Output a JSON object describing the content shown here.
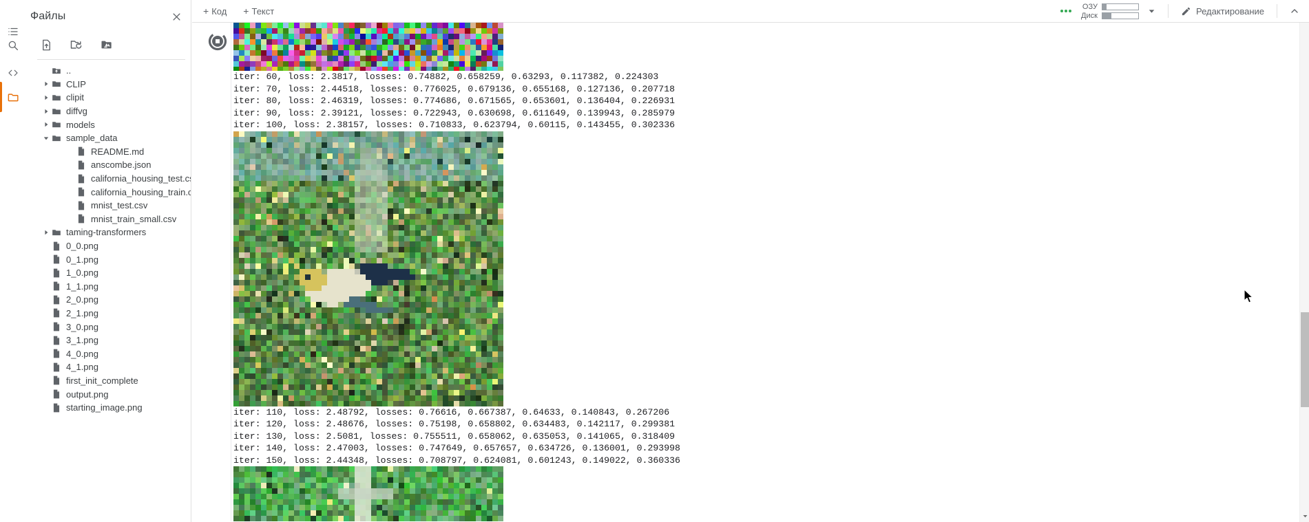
{
  "window": {
    "app": "Google Colab Notebook",
    "accent_color": "#e8710a",
    "text_color": "#3c4043",
    "background": "#ffffff"
  },
  "rail": {
    "items": [
      {
        "name": "table-of-contents-icon",
        "icon": "list-icon",
        "active": false
      },
      {
        "name": "search-icon",
        "icon": "search-icon",
        "active": false
      },
      {
        "name": "code-snippets-icon",
        "icon": "code-brackets-icon",
        "active": false
      },
      {
        "name": "files-icon",
        "icon": "folder-icon",
        "active": true
      }
    ]
  },
  "files_panel": {
    "title": "Файлы",
    "close_label": "×",
    "toolbar": [
      {
        "name": "upload-file-button",
        "icon": "upload-file-icon"
      },
      {
        "name": "refresh-folder-button",
        "icon": "folder-refresh-icon"
      },
      {
        "name": "mount-drive-button",
        "icon": "google-drive-folder-icon"
      }
    ],
    "tree": [
      {
        "label": "..",
        "type": "up",
        "indent": 1,
        "twisty": "none"
      },
      {
        "label": "CLIP",
        "type": "folder",
        "indent": 1,
        "twisty": "collapsed"
      },
      {
        "label": "clipit",
        "type": "folder",
        "indent": 1,
        "twisty": "collapsed"
      },
      {
        "label": "diffvg",
        "type": "folder",
        "indent": 1,
        "twisty": "collapsed"
      },
      {
        "label": "models",
        "type": "folder",
        "indent": 1,
        "twisty": "collapsed"
      },
      {
        "label": "sample_data",
        "type": "folder",
        "indent": 1,
        "twisty": "expanded"
      },
      {
        "label": "README.md",
        "type": "file",
        "indent": 2,
        "twisty": "none"
      },
      {
        "label": "anscombe.json",
        "type": "file",
        "indent": 2,
        "twisty": "none"
      },
      {
        "label": "california_housing_test.csv",
        "type": "file",
        "indent": 2,
        "twisty": "none"
      },
      {
        "label": "california_housing_train.csv",
        "type": "file",
        "indent": 2,
        "twisty": "none"
      },
      {
        "label": "mnist_test.csv",
        "type": "file",
        "indent": 2,
        "twisty": "none"
      },
      {
        "label": "mnist_train_small.csv",
        "type": "file",
        "indent": 2,
        "twisty": "none"
      },
      {
        "label": "taming-transformers",
        "type": "folder",
        "indent": 1,
        "twisty": "collapsed"
      },
      {
        "label": "0_0.png",
        "type": "file",
        "indent": 1,
        "twisty": "none"
      },
      {
        "label": "0_1.png",
        "type": "file",
        "indent": 1,
        "twisty": "none"
      },
      {
        "label": "1_0.png",
        "type": "file",
        "indent": 1,
        "twisty": "none"
      },
      {
        "label": "1_1.png",
        "type": "file",
        "indent": 1,
        "twisty": "none"
      },
      {
        "label": "2_0.png",
        "type": "file",
        "indent": 1,
        "twisty": "none"
      },
      {
        "label": "2_1.png",
        "type": "file",
        "indent": 1,
        "twisty": "none"
      },
      {
        "label": "3_0.png",
        "type": "file",
        "indent": 1,
        "twisty": "none"
      },
      {
        "label": "3_1.png",
        "type": "file",
        "indent": 1,
        "twisty": "none"
      },
      {
        "label": "4_0.png",
        "type": "file",
        "indent": 1,
        "twisty": "none"
      },
      {
        "label": "4_1.png",
        "type": "file",
        "indent": 1,
        "twisty": "none"
      },
      {
        "label": "first_init_complete",
        "type": "file",
        "indent": 1,
        "twisty": "none"
      },
      {
        "label": "output.png",
        "type": "file",
        "indent": 1,
        "twisty": "none"
      },
      {
        "label": "starting_image.png",
        "type": "file",
        "indent": 1,
        "twisty": "none"
      }
    ]
  },
  "toolbar": {
    "add_code_label": "Код",
    "add_text_label": "Текст",
    "add_symbol": "+",
    "ram_label": "ОЗУ",
    "disk_label": "Диск",
    "ram_percent": 12,
    "disk_percent": 26,
    "status_dots": 3,
    "status_color": "#34a853",
    "edit_label": "Редактирование",
    "edit_icon": "pencil-icon",
    "dropdown_icon": "chevron-down-icon",
    "collapse_icon": "chevron-up-icon"
  },
  "notebook": {
    "run_indicator": "busy-stop-icon",
    "outputs": [
      {
        "type": "image",
        "name": "generated-image-preview-top",
        "caption": "pixelated abstract color noise strip"
      },
      {
        "type": "stream",
        "name": "iteration-log-block-1",
        "lines": [
          "iter: 60, loss: 2.3817, losses: 0.74882, 0.658259, 0.63293, 0.117382, 0.224303",
          "iter: 70, loss: 2.44518, losses: 0.776025, 0.679136, 0.655168, 0.127136, 0.207718",
          "iter: 80, loss: 2.46319, losses: 0.774686, 0.671565, 0.653601, 0.136404, 0.226931",
          "iter: 90, loss: 2.39121, losses: 0.722943, 0.630698, 0.611649, 0.139943, 0.285979",
          "iter: 100, loss: 2.38157, losses: 0.710833, 0.623794, 0.60115, 0.143455, 0.302336"
        ]
      },
      {
        "type": "image",
        "name": "generated-image-preview-village-bird",
        "caption": "pixelated green village scene with a bird"
      },
      {
        "type": "stream",
        "name": "iteration-log-block-2",
        "lines": [
          "iter: 110, loss: 2.48792, losses: 0.76616, 0.667387, 0.64633, 0.140843, 0.267206",
          "iter: 120, loss: 2.48676, losses: 0.75198, 0.658802, 0.634483, 0.142117, 0.299381",
          "iter: 130, loss: 2.5081, losses: 0.755511, 0.658062, 0.635053, 0.141065, 0.318409",
          "iter: 140, loss: 2.47003, losses: 0.747649, 0.657657, 0.634726, 0.136001, 0.293998",
          "iter: 150, loss: 2.44348, losses: 0.708797, 0.624081, 0.601243, 0.149022, 0.360336"
        ]
      },
      {
        "type": "image",
        "name": "generated-image-preview-bottom",
        "caption": "pixelated green scene partially visible"
      }
    ]
  },
  "scrollbar": {
    "name": "vertical-scrollbar",
    "thumb_top_percent": 58,
    "thumb_height_percent": 19
  }
}
